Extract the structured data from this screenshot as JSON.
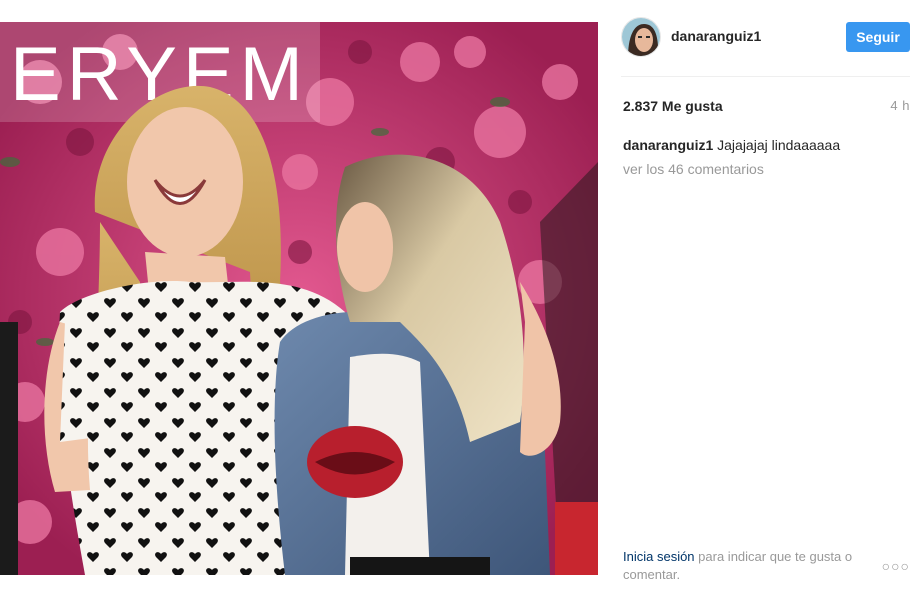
{
  "header": {
    "username": "danaranguiz1",
    "follow_label": "Seguir"
  },
  "post": {
    "likes": "2.837 Me gusta",
    "time_ago": "4 h",
    "caption_user": "danaranguiz1",
    "caption_text": "Jajajajaj lindaaaaaa",
    "view_comments": "ver los 46 comentarios",
    "sign": "ERYEM"
  },
  "footer": {
    "login_link": "Inicia sesión",
    "login_text": "para indicar que te gusta o comentar.",
    "more_icon": "○○○"
  },
  "colors": {
    "accent": "#3897f0",
    "link": "#003569",
    "muted": "#999999",
    "flowers": "#c0306a"
  },
  "icons": [
    "more-options-icon"
  ]
}
